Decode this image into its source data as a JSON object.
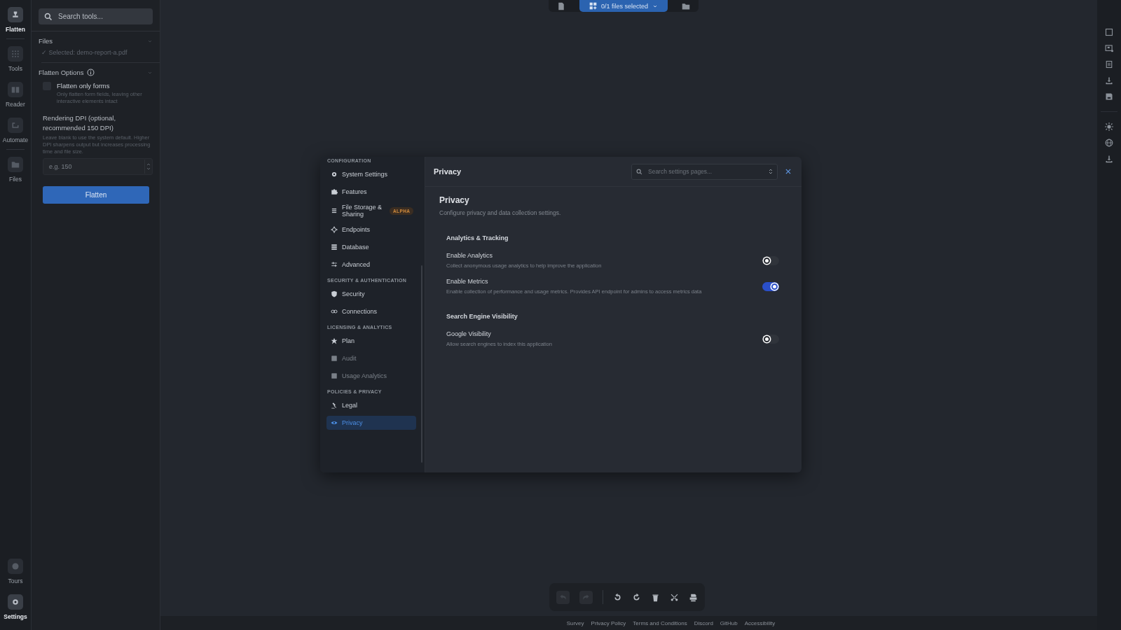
{
  "rail": {
    "top": [
      {
        "label": "Flatten",
        "selected": true
      },
      {
        "label": "Tools",
        "selected": false
      },
      {
        "label": "Reader",
        "selected": false
      },
      {
        "label": "Automate",
        "selected": false
      },
      {
        "label": "Files",
        "selected": false
      }
    ],
    "bottom": [
      {
        "label": "Tours",
        "selected": false
      },
      {
        "label": "Settings",
        "selected": true
      }
    ]
  },
  "tool_panel": {
    "search": {
      "placeholder": "Search tools..."
    },
    "files": {
      "title": "Files",
      "selected_file": "✓ Selected: demo-report-a.pdf"
    },
    "options": {
      "title": "Flatten Options",
      "checkbox": {
        "label": "Flatten only forms",
        "description": "Only flatten form fields, leaving other interactive elements intact",
        "checked": false
      },
      "dpi": {
        "label": "Rendering DPI (optional, recommended 150 DPI)",
        "help": "Leave blank to use the system default. Higher DPI sharpens output but increases processing time and file size.",
        "placeholder": "e.g. 150"
      }
    },
    "button": "Flatten"
  },
  "file_bar": {
    "label": "0/1 files selected"
  },
  "settings": {
    "nav": [
      {
        "title": "CONFIGURATION",
        "items": [
          {
            "label": "System Settings",
            "selected": false
          },
          {
            "label": "Features",
            "selected": false
          },
          {
            "label": "File Storage & Sharing",
            "selected": false,
            "badge": "ALPHA"
          },
          {
            "label": "Endpoints",
            "selected": false
          },
          {
            "label": "Database",
            "selected": false
          },
          {
            "label": "Advanced",
            "selected": false
          }
        ]
      },
      {
        "title": "SECURITY & AUTHENTICATION",
        "items": [
          {
            "label": "Security",
            "selected": false
          },
          {
            "label": "Connections",
            "selected": false
          }
        ]
      },
      {
        "title": "LICENSING & ANALYTICS",
        "items": [
          {
            "label": "Plan",
            "selected": false
          },
          {
            "label": "Audit",
            "selected": false,
            "disabled": true
          },
          {
            "label": "Usage Analytics",
            "selected": false,
            "disabled": true
          }
        ]
      },
      {
        "title": "POLICIES & PRIVACY",
        "items": [
          {
            "label": "Legal",
            "selected": false
          },
          {
            "label": "Privacy",
            "selected": true
          }
        ]
      }
    ],
    "header": {
      "title": "Privacy",
      "search_placeholder": "Search settings pages..."
    },
    "page": {
      "title": "Privacy",
      "subtitle": "Configure privacy and data collection settings."
    },
    "groups": [
      {
        "title": "Analytics & Tracking",
        "settings": [
          {
            "label": "Enable Analytics",
            "description": "Collect anonymous usage analytics to help improve the application",
            "on": false
          },
          {
            "label": "Enable Metrics",
            "description": "Enable collection of performance and usage metrics. Provides API endpoint for admins to access metrics data",
            "on": true
          }
        ]
      },
      {
        "title": "Search Engine Visibility",
        "settings": [
          {
            "label": "Google Visibility",
            "description": "Allow search engines to index this application",
            "on": false
          }
        ]
      }
    ]
  },
  "footer": [
    "Survey",
    "Privacy Policy",
    "Terms and Conditions",
    "Discord",
    "GitHub",
    "Accessibility"
  ]
}
